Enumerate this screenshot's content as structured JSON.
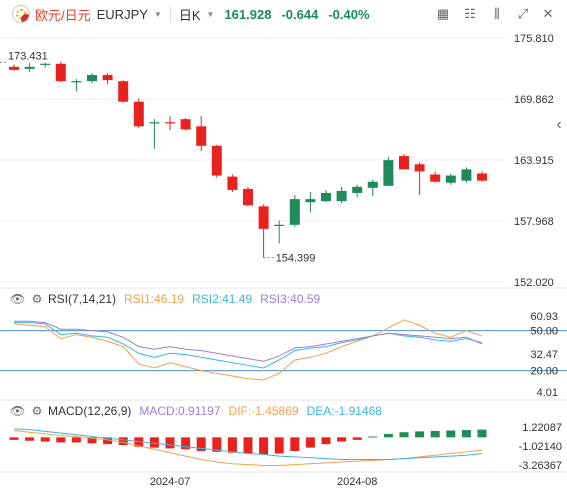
{
  "header": {
    "pair_cn": "欧元/日元",
    "pair": "EURJPY",
    "timeframe": "日K",
    "price": "161.928",
    "change": "-0.644",
    "change_pct": "-0.40%"
  },
  "price_axis": [
    "175.810",
    "169.862",
    "163.915",
    "157.968",
    "152.020"
  ],
  "price_range": [
    152.02,
    175.81
  ],
  "high_label": "173.431",
  "low_label": "154.399",
  "candles": [
    [
      173.0,
      173.2,
      172.6,
      172.7
    ],
    [
      172.8,
      173.4,
      172.5,
      173.0
    ],
    [
      173.2,
      173.4,
      172.9,
      173.3
    ],
    [
      173.3,
      173.5,
      171.5,
      171.6
    ],
    [
      171.5,
      171.8,
      170.6,
      171.6
    ],
    [
      171.6,
      172.4,
      171.4,
      172.2
    ],
    [
      172.2,
      172.4,
      171.3,
      171.7
    ],
    [
      171.6,
      171.7,
      169.5,
      169.6
    ],
    [
      169.6,
      169.9,
      167.0,
      167.2
    ],
    [
      167.5,
      167.9,
      165.0,
      167.6
    ],
    [
      167.6,
      168.2,
      166.8,
      167.5
    ],
    [
      167.9,
      168.0,
      166.8,
      166.9
    ],
    [
      167.2,
      168.2,
      164.8,
      165.3
    ],
    [
      165.3,
      165.4,
      162.2,
      162.4
    ],
    [
      162.3,
      162.5,
      160.8,
      161.0
    ],
    [
      161.1,
      161.3,
      159.4,
      159.5
    ],
    [
      159.4,
      159.6,
      154.4,
      157.2
    ],
    [
      157.5,
      158.0,
      155.8,
      157.6
    ],
    [
      157.6,
      160.5,
      157.4,
      160.1
    ],
    [
      159.8,
      160.8,
      158.8,
      160.1
    ],
    [
      159.9,
      161.0,
      159.8,
      160.7
    ],
    [
      159.9,
      161.3,
      159.7,
      160.9
    ],
    [
      160.7,
      161.5,
      160.3,
      161.3
    ],
    [
      161.2,
      162.0,
      160.4,
      161.8
    ],
    [
      161.4,
      164.2,
      161.4,
      163.9
    ],
    [
      164.3,
      164.5,
      163.0,
      163.0
    ],
    [
      163.5,
      163.7,
      160.5,
      162.8
    ],
    [
      162.5,
      162.8,
      161.7,
      161.8
    ],
    [
      161.7,
      162.6,
      161.5,
      162.4
    ],
    [
      161.9,
      163.2,
      161.7,
      163.0
    ],
    [
      162.6,
      162.8,
      161.8,
      161.9
    ]
  ],
  "rsi": {
    "title": "RSI(7,14,21)",
    "rsi1": "RSI1:46.19",
    "rsi2": "RSI2:41.49",
    "rsi3": "RSI3:40.59",
    "levels": [
      "60.93",
      "50.00",
      "32.47",
      "20.00",
      "4.01"
    ],
    "range": [
      4.01,
      60.93
    ],
    "series": [
      {
        "color": "#f0a050",
        "values": [
          55,
          54,
          53,
          44,
          47,
          45,
          42,
          38,
          25,
          22,
          26,
          23,
          20,
          18,
          16,
          14,
          13,
          18,
          28,
          30,
          33,
          38,
          42,
          46,
          52,
          58,
          54,
          48,
          45,
          50,
          46
        ]
      },
      {
        "color": "#3cb4e6",
        "values": [
          56,
          56,
          55,
          47,
          48,
          46,
          45,
          40,
          33,
          30,
          33,
          32,
          30,
          28,
          26,
          24,
          22,
          28,
          35,
          37,
          38,
          41,
          43,
          46,
          48,
          46,
          45,
          43,
          42,
          44,
          41
        ]
      },
      {
        "color": "#9b7fd4",
        "values": [
          57,
          57,
          56,
          51,
          51,
          50,
          49,
          45,
          38,
          36,
          38,
          36,
          35,
          33,
          31,
          29,
          27,
          31,
          37,
          38,
          40,
          42,
          44,
          46,
          48,
          47,
          46,
          45,
          44,
          45,
          40
        ]
      }
    ]
  },
  "macd": {
    "title": "MACD(12,26,9)",
    "macd_label": "MACD:0.91197",
    "dif_label": "DIF:-1.45869",
    "dea_label": "DEA:-1.91468",
    "levels": [
      "1.22087",
      "-1.02140",
      "-3.26367"
    ],
    "range": [
      -3.6,
      1.8
    ],
    "hist": [
      -0.3,
      -0.4,
      -0.5,
      -0.6,
      -0.6,
      -0.7,
      -0.8,
      -0.9,
      -1.1,
      -1.2,
      -1.3,
      -1.4,
      -1.6,
      -1.7,
      -1.8,
      -1.9,
      -2.0,
      -1.9,
      -1.6,
      -1.2,
      -0.8,
      -0.5,
      -0.3,
      0.1,
      0.4,
      0.6,
      0.7,
      0.75,
      0.8,
      0.85,
      0.9
    ],
    "dif": [
      0.8,
      0.6,
      0.4,
      0.2,
      0.1,
      -0.1,
      -0.3,
      -0.6,
      -1.0,
      -1.4,
      -1.8,
      -2.2,
      -2.6,
      -2.9,
      -3.1,
      -3.2,
      -3.3,
      -3.3,
      -3.2,
      -3.1,
      -3.0,
      -2.9,
      -2.8,
      -2.7,
      -2.6,
      -2.5,
      -2.3,
      -2.1,
      -1.9,
      -1.7,
      -1.5
    ],
    "dea": [
      1.0,
      0.9,
      0.7,
      0.5,
      0.3,
      0.1,
      -0.1,
      -0.3,
      -0.5,
      -0.7,
      -0.9,
      -1.1,
      -1.3,
      -1.5,
      -1.7,
      -1.9,
      -2.0,
      -2.2,
      -2.3,
      -2.4,
      -2.5,
      -2.6,
      -2.6,
      -2.6,
      -2.6,
      -2.5,
      -2.4,
      -2.3,
      -2.2,
      -2.1,
      -1.9
    ],
    "dif_color": "#f0a050",
    "dea_color": "#3cb4e6"
  },
  "x_axis": [
    "2024-07",
    "2024-08"
  ],
  "colors": {
    "up": "#1f8a5c",
    "down": "#e8231f",
    "level_line": "#4a90d9",
    "grid": "#eeeeee"
  }
}
